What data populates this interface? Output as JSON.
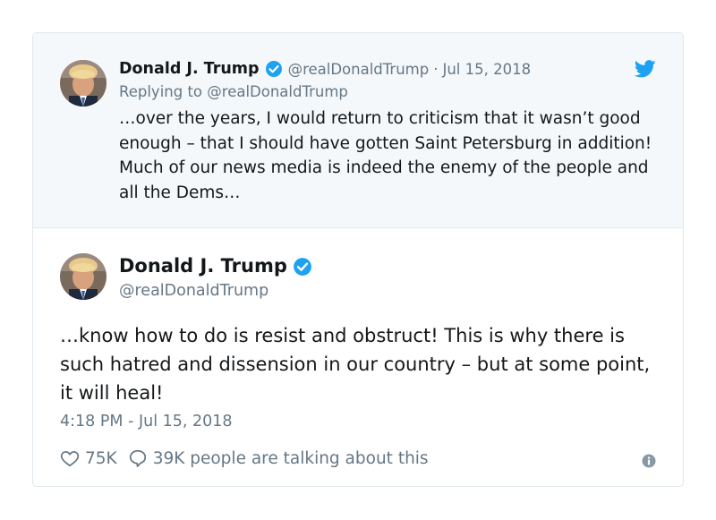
{
  "quoted_tweet": {
    "author_name": "Donald J. Trump",
    "handle": "@realDonaldTrump",
    "separator": "·",
    "date": "Jul 15, 2018",
    "replying_to": "Replying to @realDonaldTrump",
    "text": "…over the years, I would return to criticism that it wasn’t good enough – that I should have gotten Saint Petersburg in addition! Much of our news media is indeed the enemy of the people and all the Dems…",
    "avatar_icon": "profile-photo",
    "verified_icon": "verified-badge-icon",
    "platform_icon": "twitter-bird-icon"
  },
  "main_tweet": {
    "author_name": "Donald J. Trump",
    "handle": "@realDonaldTrump",
    "text": "…know how to do is resist and obstruct! This is why there is such hatred and dissension in our country – but at some point, it will heal!",
    "timestamp": "4:18 PM - Jul 15, 2018",
    "avatar_icon": "profile-photo",
    "verified_icon": "verified-badge-icon"
  },
  "actions": {
    "like_icon": "heart-icon",
    "like_count": "75K",
    "reply_icon": "speech-bubble-icon",
    "talking_text": "39K people are talking about this",
    "info_icon": "info-icon"
  },
  "colors": {
    "brand_blue": "#1da1f2",
    "secondary_text": "#657786",
    "quoted_background": "#f5f8fa",
    "border": "#e1e8ed"
  }
}
